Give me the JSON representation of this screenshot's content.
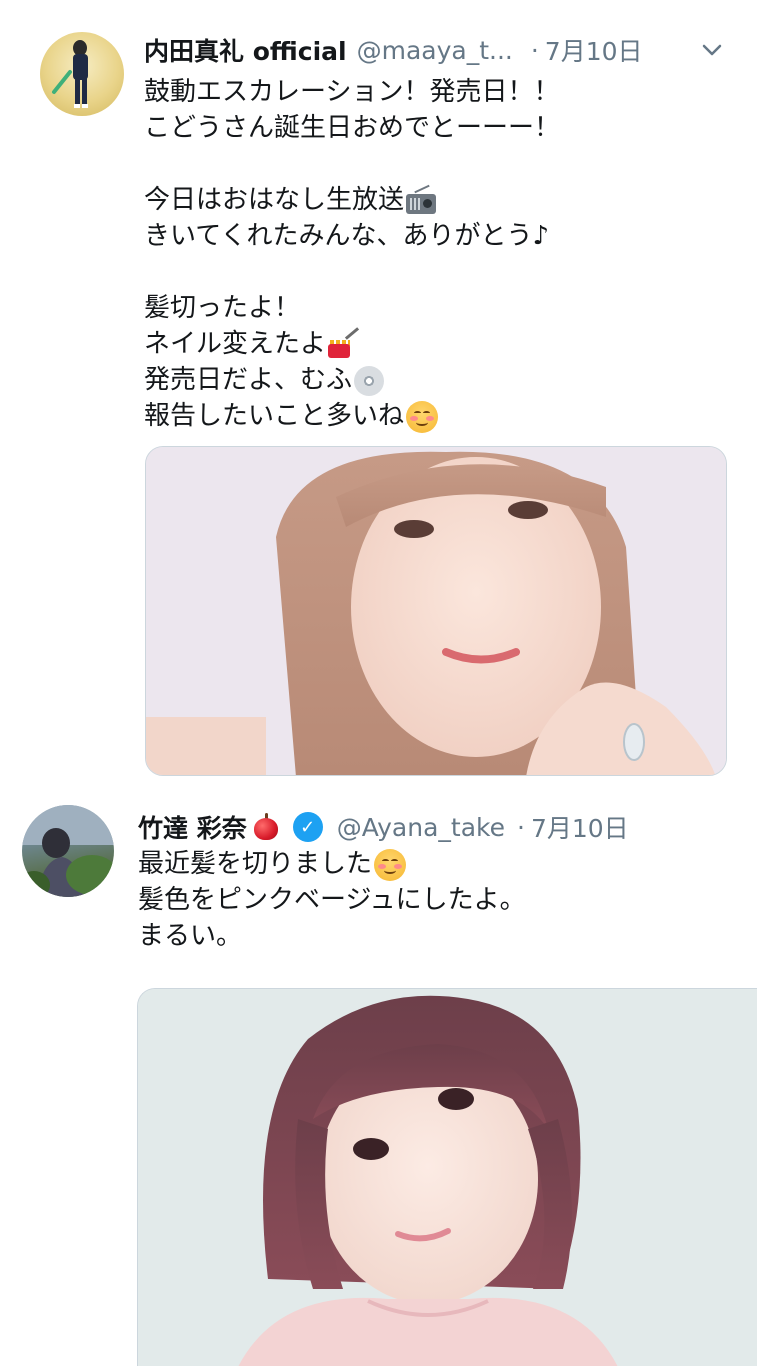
{
  "tweets": [
    {
      "display_name": "内田真礼 official",
      "handle": "@maaya_t...",
      "separator": "·",
      "date": "7月10日",
      "text_lines": [
        "鼓動エスカレーション！発売日！！",
        "こどうさん誕生日おめでとーーー！",
        "",
        "今日はおはなし生放送",
        "きいてくれたみんな、ありがとう♪",
        "",
        "髪切ったよ！",
        "ネイル変えたよ",
        "発売日だよ、むふ",
        "報告したいこと多いね"
      ],
      "avatar_alt": "profile-photo",
      "media_alt": "selfie-photo"
    },
    {
      "display_name": "竹達 彩奈",
      "handle": "@Ayana_take",
      "separator": "·",
      "date": "7月10日",
      "text_lines": [
        "最近髪を切りました",
        "髪色をピンクベージュにしたよ。",
        "まるい。"
      ],
      "avatar_alt": "profile-photo",
      "media_alt": "selfie-photo",
      "verified": true
    }
  ],
  "icons": {
    "more_menu": "chevron-down-icon",
    "verified": "verified-badge-icon",
    "radio": "radio-emoji",
    "nail_polish": "nail-polish-emoji",
    "disc": "dvd-emoji",
    "smile": "smiling-face-emoji",
    "apple": "red-apple-emoji"
  },
  "colors": {
    "text": "#14171a",
    "secondary": "#657786",
    "verified": "#1da1f2",
    "border": "#ccd6dd"
  }
}
